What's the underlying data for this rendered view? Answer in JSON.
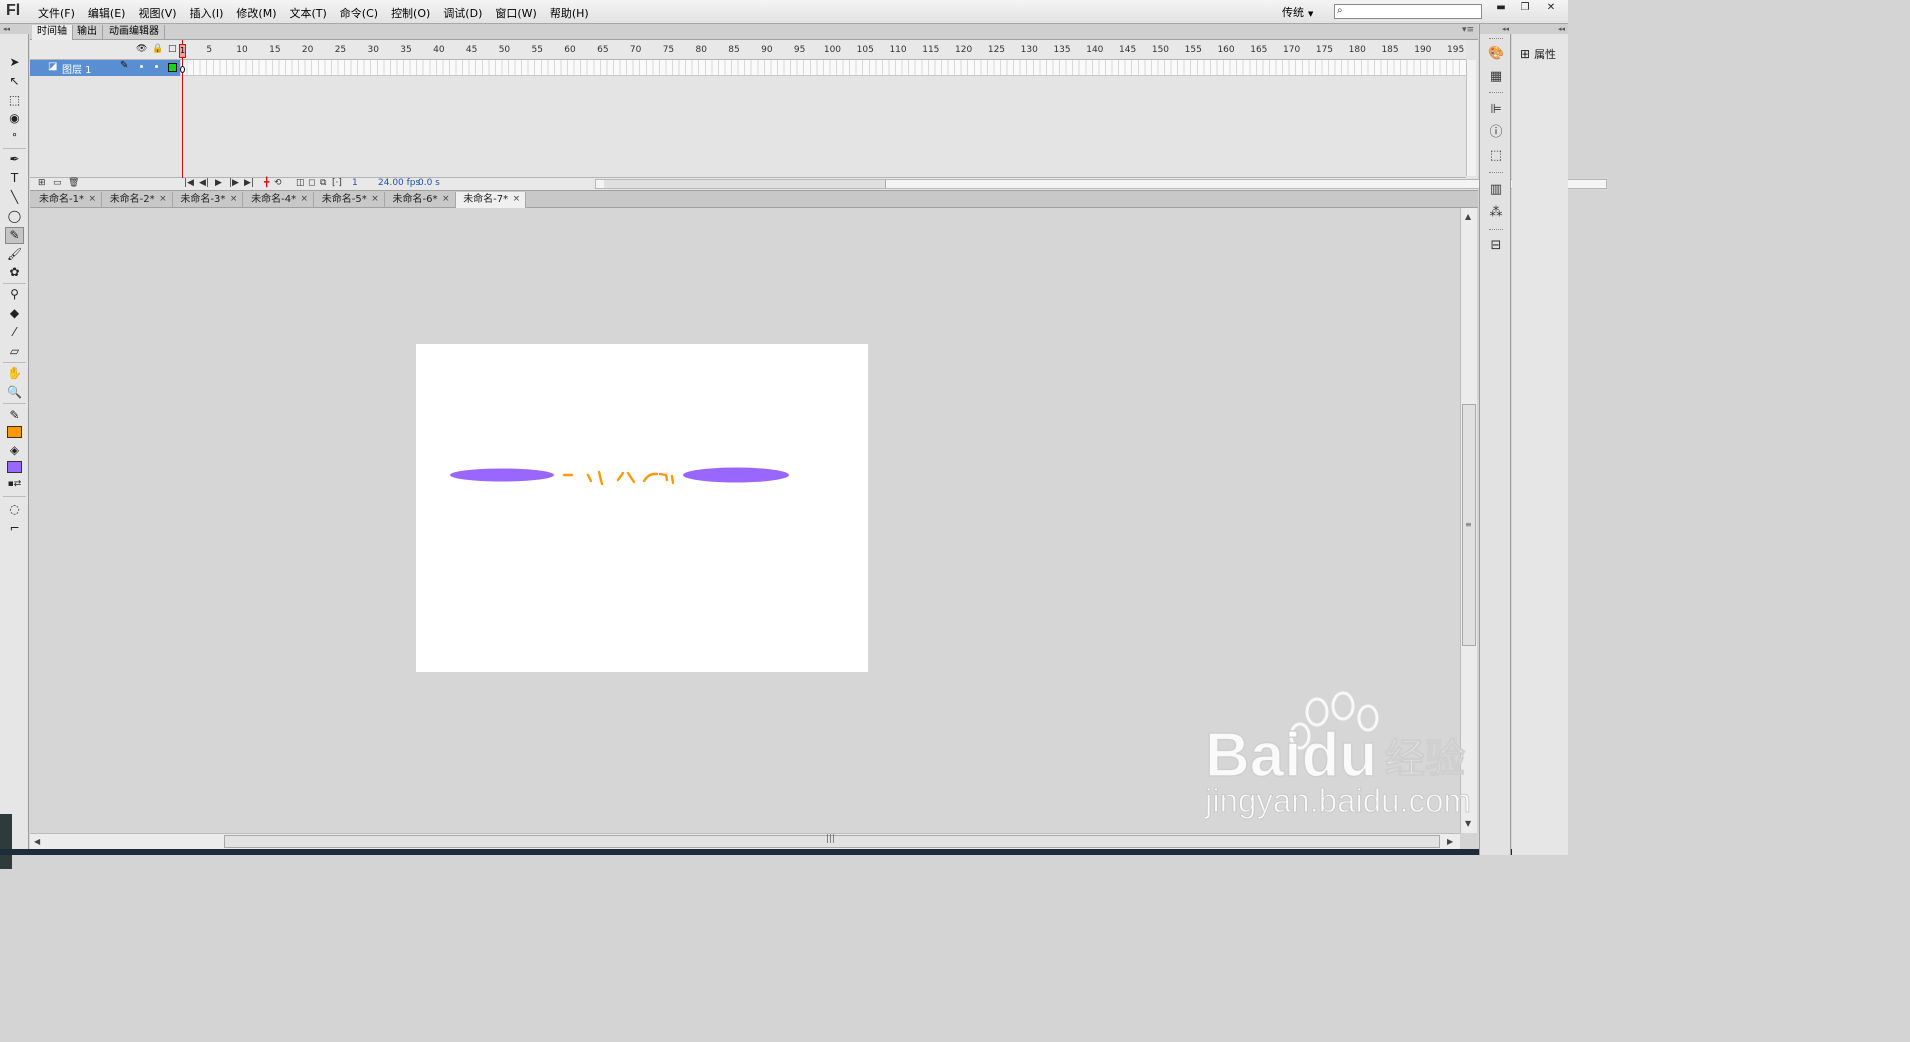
{
  "app": {
    "logo": "Fl"
  },
  "menu": [
    "文件(F)",
    "编辑(E)",
    "视图(V)",
    "插入(I)",
    "修改(M)",
    "文本(T)",
    "命令(C)",
    "控制(O)",
    "调试(D)",
    "窗口(W)",
    "帮助(H)"
  ],
  "workspace": {
    "label": "传统"
  },
  "search": {
    "value": "",
    "icon": "search-icon"
  },
  "window_controls": {
    "minimize": "▬",
    "restore": "❐",
    "close": "✕"
  },
  "timeline_tabs": [
    "时间轴",
    "输出",
    "动画编辑器"
  ],
  "layer": {
    "name": "图层 1"
  },
  "ruler": {
    "marks": [
      1,
      5,
      10,
      15,
      20,
      25,
      30,
      35,
      40,
      45,
      50,
      55,
      60,
      65,
      70,
      75,
      80,
      85,
      90,
      95,
      100,
      105,
      110,
      115,
      120,
      125,
      130,
      135,
      140,
      145,
      150,
      155,
      160,
      165,
      170,
      175,
      180,
      185,
      190,
      195
    ]
  },
  "playhead": {
    "current_frame": "1"
  },
  "status": {
    "frame": "1",
    "fps": "24.00 fps",
    "time": "0.0 s"
  },
  "doc_tabs": [
    "未命名-1*",
    "未命名-2*",
    "未命名-3*",
    "未命名-4*",
    "未命名-5*",
    "未命名-6*",
    "未命名-7*"
  ],
  "active_doc_tab": 6,
  "stage": {
    "background": "#ffffff",
    "shapes": {
      "left_ellipse_color": "#9966ff",
      "right_ellipse_color": "#9966ff",
      "stroke_color": "#ff9900"
    }
  },
  "colors": {
    "stroke": "#ff9900",
    "fill": "#9966ff",
    "accent_layer": "#5a8ed2"
  },
  "right_panel": {
    "properties_label": "属性"
  },
  "watermark": {
    "brand": "Baidu",
    "suffix": "经验",
    "url": "jingyan.baidu.com"
  }
}
